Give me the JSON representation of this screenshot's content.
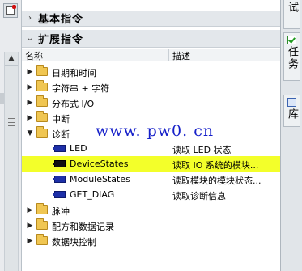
{
  "sections": {
    "basic": {
      "label": "基本指令",
      "arrow": "›"
    },
    "extended": {
      "label": "扩展指令",
      "arrow": "⌄"
    }
  },
  "columns": {
    "name": "名称",
    "description": "描述"
  },
  "tree": {
    "folder_date_time": "日期和时间",
    "folder_string": "字符串 + 字符",
    "folder_distributed_io": "分布式 I/O",
    "folder_interrupt": "中断",
    "folder_diagnostics": "诊断",
    "led": {
      "name": "LED",
      "desc": "读取 LED 状态"
    },
    "device_states": {
      "name": "DeviceStates",
      "desc": "读取 IO 系统的模块..."
    },
    "module_states": {
      "name": "ModuleStates",
      "desc": "读取模块的模块状态..."
    },
    "get_diag": {
      "name": "GET_DIAG",
      "desc": "读取诊断信息"
    },
    "folder_pulse": "脉冲",
    "folder_recipe": "配方和数据记录",
    "folder_data_block": "数据块控制"
  },
  "watermark": "www. pw0. cn",
  "right_tabs": {
    "test": "试",
    "tasks": "任务",
    "libraries": "库"
  },
  "colors": {
    "selection": "#f3ff2a",
    "folder": "#f0c652",
    "function_block": "#1d2fa8",
    "watermark": "#1620c9"
  }
}
